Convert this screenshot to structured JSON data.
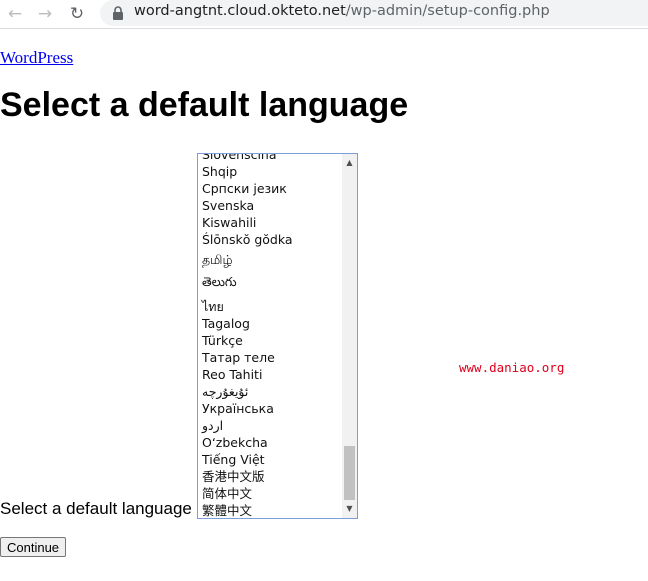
{
  "browser": {
    "back_icon": "←",
    "forward_icon": "→",
    "reload_icon": "↻",
    "url_host": "word-angtnt.cloud.okteto.net",
    "url_path": "/wp-admin/setup-config.php"
  },
  "page": {
    "logo_link": "WordPress",
    "title": "Select a default language",
    "select_label": "Select a default language",
    "continue_button": "Continue",
    "watermark": "www.daniao.org"
  },
  "languages": {
    "items": [
      "Slovenščina",
      "Shqip",
      "Српски језик",
      "Svenska",
      "Kiswahili",
      "Ślōnskŏ gŏdka",
      "தமிழ்",
      "తెలుగు",
      "ไทย",
      "Tagalog",
      "Türkçe",
      "Татар теле",
      "Reo Tahiti",
      "ئۇيغۇرچە",
      "Українська",
      "اردو",
      "O‘zbekcha",
      "Tiếng Việt",
      "香港中文版",
      "简体中文",
      "繁體中文"
    ],
    "scroll_up_icon": "▲",
    "scroll_down_icon": "▼"
  }
}
